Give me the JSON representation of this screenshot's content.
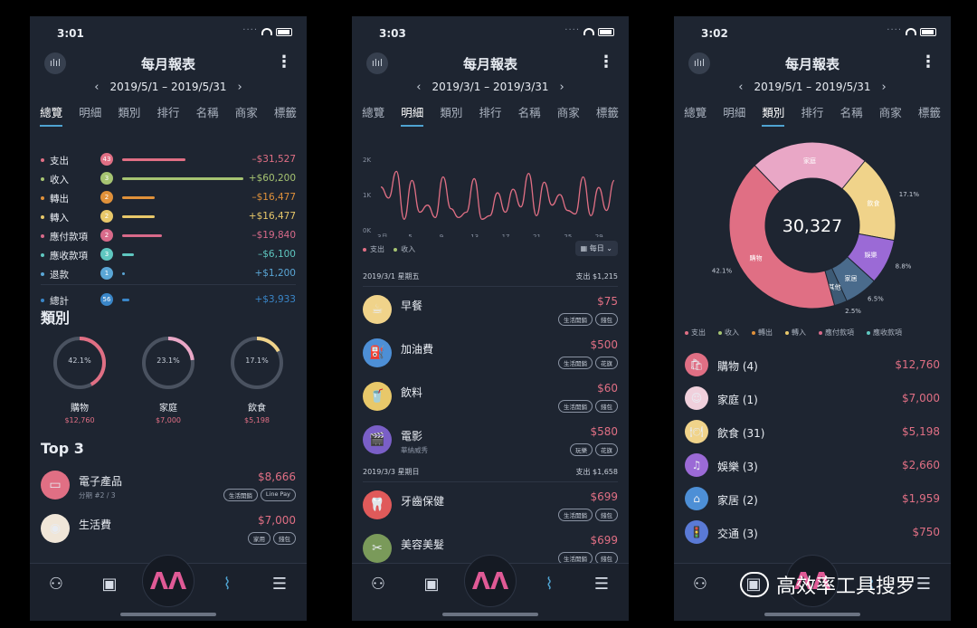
{
  "phones": [
    {
      "time": "3:01",
      "title": "每月報表",
      "range": "2019/5/1 – 2019/5/31",
      "tabs": [
        "總覽",
        "明細",
        "類別",
        "排行",
        "名稱",
        "商家",
        "標籤"
      ],
      "summary": [
        {
          "label": "支出",
          "count": "43",
          "amount": "–$31,527",
          "color": "#e06f84",
          "bar": 0.52
        },
        {
          "label": "收入",
          "count": "3",
          "amount": "+$60,200",
          "color": "#a6c472",
          "bar": 1.0
        },
        {
          "label": "轉出",
          "count": "2",
          "amount": "–$16,477",
          "color": "#e0913a",
          "bar": 0.27
        },
        {
          "label": "轉入",
          "count": "2",
          "amount": "+$16,477",
          "color": "#e8c86a",
          "bar": 0.27
        },
        {
          "label": "應付款項",
          "count": "2",
          "amount": "–$19,840",
          "color": "#d86a8a",
          "bar": 0.33
        },
        {
          "label": "應收款項",
          "count": "3",
          "amount": "–$6,100",
          "color": "#5fc7c0",
          "bar": 0.1
        },
        {
          "label": "退款",
          "count": "1",
          "amount": "+$1,200",
          "color": "#5aa6d6",
          "bar": 0.02
        },
        {
          "label": "總計",
          "count": "56",
          "amount": "+$3,933",
          "color": "#3a86c8",
          "bar": 0.06
        }
      ],
      "category_title": "類別",
      "rings": [
        {
          "pct": "42.1%",
          "value": 0.421,
          "name": "購物",
          "amount": "$12,760",
          "color": "#e06f84"
        },
        {
          "pct": "23.1%",
          "value": 0.231,
          "name": "家庭",
          "amount": "$7,000",
          "color": "#e9a7c6"
        },
        {
          "pct": "17.1%",
          "value": 0.171,
          "name": "飲食",
          "amount": "$5,198",
          "color": "#f0d38a"
        }
      ],
      "top_title": "Top 3",
      "top_items": [
        {
          "icon": "laptop-icon",
          "glyph": "▭",
          "bg": "#e06f84",
          "name": "電子產品",
          "sub": "分期 #2 / 3",
          "amount": "$8,666",
          "tags": [
            "生活開銷",
            "Line Pay"
          ]
        },
        {
          "icon": "bottle-icon",
          "glyph": "◉",
          "bg": "#f0e6d8",
          "name": "生活費",
          "sub": "",
          "amount": "$7,000",
          "tags": [
            "家用",
            "錢包"
          ]
        }
      ]
    },
    {
      "time": "3:03",
      "title": "每月報表",
      "range": "2019/3/1 – 2019/3/31",
      "tabs": [
        "總覽",
        "明細",
        "類別",
        "排行",
        "名稱",
        "商家",
        "標籤"
      ],
      "legend": [
        "支出",
        "收入"
      ],
      "daily_label": "每日",
      "day_groups": [
        {
          "date": "2019/3/1 星期五",
          "total": "支出 $1,215"
        },
        {
          "date": "2019/3/3 星期日",
          "total": "支出 $1,658"
        }
      ],
      "items": [
        {
          "icon": "breakfast-icon",
          "glyph": "☕",
          "bg": "#f0d38a",
          "name": "早餐",
          "sub": "",
          "amount": "$75",
          "tags": [
            "生活開銷",
            "錢包"
          ]
        },
        {
          "icon": "fuel-icon",
          "glyph": "⛽",
          "bg": "#4d8fd6",
          "name": "加油費",
          "sub": "",
          "amount": "$500",
          "tags": [
            "生活開銷",
            "花旗"
          ]
        },
        {
          "icon": "drink-icon",
          "glyph": "🥤",
          "bg": "#e8c86a",
          "name": "飲料",
          "sub": "",
          "amount": "$60",
          "tags": [
            "生活開銷",
            "錢包"
          ]
        },
        {
          "icon": "movie-icon",
          "glyph": "🎬",
          "bg": "#7a5fc7",
          "name": "電影",
          "sub": "華納威秀",
          "amount": "$580",
          "tags": [
            "玩樂",
            "花旗"
          ]
        },
        {
          "icon": "tooth-icon",
          "glyph": "🦷",
          "bg": "#e05a5a",
          "name": "牙齒保健",
          "sub": "",
          "amount": "$699",
          "tags": [
            "生活開銷",
            "錢包"
          ]
        },
        {
          "icon": "beauty-icon",
          "glyph": "✂",
          "bg": "#7a9a5a",
          "name": "美容美髮",
          "sub": "",
          "amount": "$699",
          "tags": [
            "生活開銷",
            "錢包"
          ]
        }
      ]
    },
    {
      "time": "3:02",
      "title": "每月報表",
      "range": "2019/5/1 – 2019/5/31",
      "tabs": [
        "總覽",
        "明細",
        "類別",
        "排行",
        "名稱",
        "商家",
        "標籤"
      ],
      "donut_center": "30,327",
      "legend": [
        {
          "label": "支出",
          "color": "#e06f84"
        },
        {
          "label": "收入",
          "color": "#a6c472"
        },
        {
          "label": "轉出",
          "color": "#e0913a"
        },
        {
          "label": "轉入",
          "color": "#e8c86a"
        },
        {
          "label": "應付款項",
          "color": "#d86a8a"
        },
        {
          "label": "應收款項",
          "color": "#5fc7c0"
        }
      ],
      "categories": [
        {
          "icon": "shopping-icon",
          "glyph": "🛍",
          "bg": "#e06f84",
          "name": "購物 (4)",
          "amount": "$12,760"
        },
        {
          "icon": "family-icon",
          "glyph": "☺",
          "bg": "#f0d0dc",
          "name": "家庭 (1)",
          "amount": "$7,000"
        },
        {
          "icon": "food-icon",
          "glyph": "🍽",
          "bg": "#f0d38a",
          "name": "飲食 (31)",
          "amount": "$5,198"
        },
        {
          "icon": "entertainment-icon",
          "glyph": "♫",
          "bg": "#9b6ad6",
          "name": "娛樂 (3)",
          "amount": "$2,660"
        },
        {
          "icon": "home-icon",
          "glyph": "⌂",
          "bg": "#4d8fd6",
          "name": "家居 (2)",
          "amount": "$1,959"
        },
        {
          "icon": "traffic-icon",
          "glyph": "🚦",
          "bg": "#5a7ad6",
          "name": "交通 (3)",
          "amount": "$750"
        }
      ]
    }
  ],
  "watermark": "高效率工具搜罗",
  "chart_data": [
    {
      "type": "line",
      "x_ticks": [
        "3月",
        "5",
        "9",
        "13",
        "17",
        "21",
        "25",
        "29"
      ],
      "y_ticks": [
        "0K",
        "1K",
        "2K"
      ],
      "ylim": [
        0,
        2000
      ],
      "series": [
        {
          "name": "支出",
          "x": [
            1,
            2,
            3,
            4,
            5,
            6,
            7,
            8,
            9,
            10,
            11,
            12,
            13,
            14,
            15,
            16,
            17,
            18,
            19,
            20,
            21,
            22,
            23,
            24,
            25,
            26,
            27,
            28,
            29,
            30,
            31
          ],
          "values": [
            1215,
            900,
            1658,
            300,
            1400,
            500,
            700,
            350,
            1500,
            600,
            350,
            500,
            1450,
            300,
            400,
            1050,
            500,
            1150,
            650,
            1600,
            400,
            1350,
            700,
            1000,
            550,
            450,
            1500,
            400,
            1200,
            550,
            1400
          ]
        }
      ]
    },
    {
      "type": "pie",
      "center_label": "30,327",
      "slices": [
        {
          "label": "購物",
          "pct": 42.1,
          "color": "#e06f84"
        },
        {
          "label": "家庭",
          "pct": 23.1,
          "color": "#e9a7c6"
        },
        {
          "label": "飲食",
          "pct": 17.1,
          "color": "#f0d38a"
        },
        {
          "label": "娛樂",
          "pct": 8.8,
          "color": "#9b6ad6"
        },
        {
          "label": "家居",
          "pct": 6.5,
          "color": "#4a6b8c"
        },
        {
          "label": "其他",
          "pct": 2.5,
          "color": "#3d5a75"
        }
      ]
    }
  ]
}
